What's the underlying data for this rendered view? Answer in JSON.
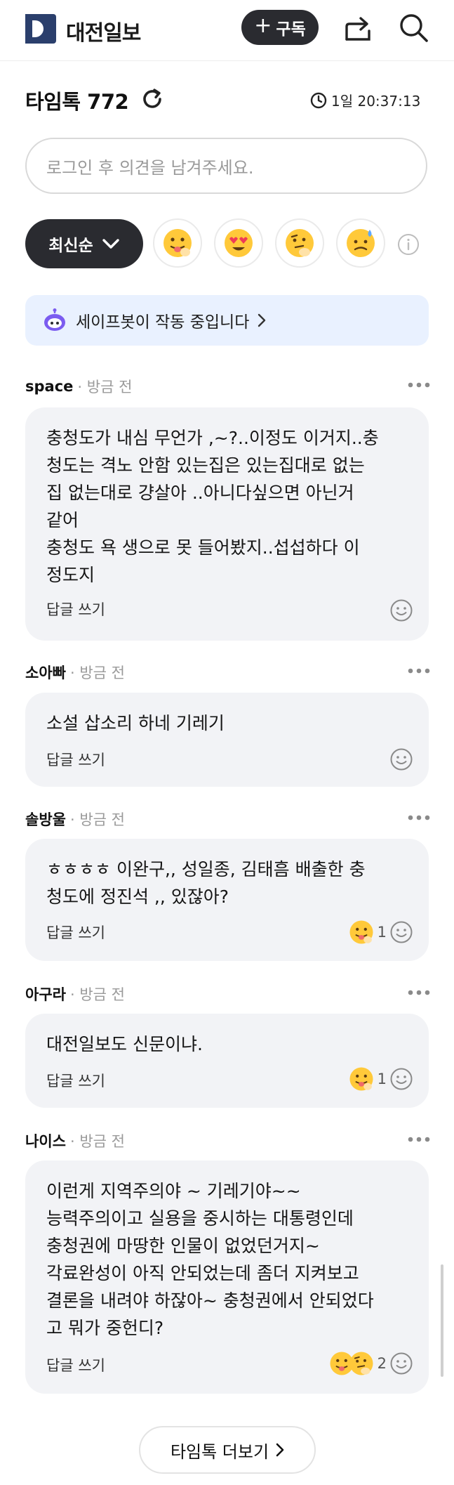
{
  "header": {
    "brand": "대전일보",
    "subscribe_label": "구독"
  },
  "timetalk": {
    "title": "타임톡 772",
    "remaining": "1일 20:37:13",
    "input_placeholder": "로그인 후 의견을 남겨주세요.",
    "sort_label": "최신순",
    "safebot_text": "세이프봇이 작동 중입니다"
  },
  "comments": [
    {
      "author": "space",
      "time": "방금 전",
      "text": "충청도가 내심 무언가 ,~?..이정도 이거지..충\n청도는 격노 안함 있는집은 있는집대로 없는\n집 없는대로 걍살아 ..아니다싶으면 아닌거\n같어\n충청도 욕 생으로 못 들어봤지..섭섭하다 이\n정도지",
      "reply_label": "답글 쓰기",
      "reaction_count": ""
    },
    {
      "author": "소아빠",
      "time": "방금 전",
      "text": "소설 삽소리 하네 기레기",
      "reply_label": "답글 쓰기",
      "reaction_count": ""
    },
    {
      "author": "솔방울",
      "time": "방금 전",
      "text": "ㅎㅎㅎㅎ 이완구,, 성일종, 김태흠 배출한 충\n청도에 정진석 ,, 있잖아?",
      "reply_label": "답글 쓰기",
      "reaction_count": "1"
    },
    {
      "author": "아구라",
      "time": "방금 전",
      "text": "대전일보도 신문이냐.",
      "reply_label": "답글 쓰기",
      "reaction_count": "1"
    },
    {
      "author": "나이스",
      "time": "방금 전",
      "text": "이런게 지역주의야 ~ 기레기야~~\n능력주의이고 실용을 중시하는 대통령인데\n충청권에 마땅한 인물이 없었던거지~\n각료완성이 아직 안되었는데 좀더 지켜보고\n결론을 내려야 하잖아~ 충청권에서 안되었다\n고 뭐가 중헌디?",
      "reply_label": "답글 쓰기",
      "reaction_count": "2"
    }
  ],
  "more_button_label": "타임톡 더보기",
  "colors": {
    "dark_button": "#2a2b30",
    "safebot_bg": "#e9f1ff",
    "comment_bg": "#f2f3f6",
    "emoji_yellow": "#ffc93a"
  }
}
